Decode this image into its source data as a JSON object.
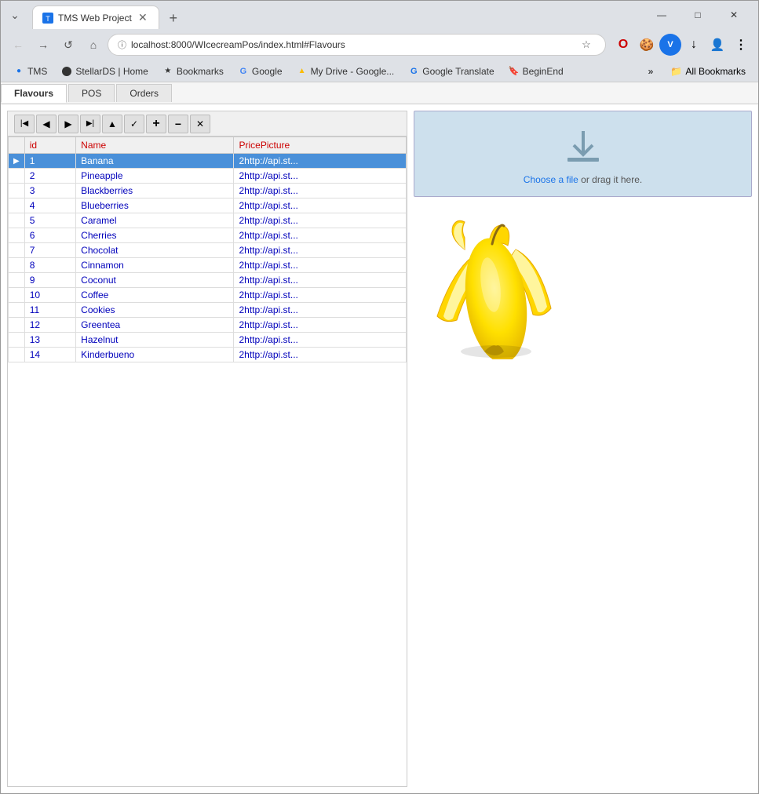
{
  "browser": {
    "tab_title": "TMS Web Project",
    "tab_favicon": "T",
    "address": "localhost:8000/WIcecreamPos/index.html#Flavours",
    "new_tab_label": "+",
    "window_controls": {
      "minimize": "—",
      "maximize": "□",
      "close": "✕"
    }
  },
  "nav_buttons": {
    "back": "←",
    "forward": "→",
    "refresh": "↺",
    "home": "⌂"
  },
  "address_icons": {
    "lock": "ⓘ",
    "star": "☆",
    "extensions": "🧩",
    "more": "⋮"
  },
  "browser_toolbar_icons": {
    "opera": "O",
    "cookie": "🍪",
    "vpn": "V",
    "download_ext": "↓",
    "profile": "👤",
    "more": "⋮"
  },
  "bookmarks": {
    "items": [
      {
        "label": "TMS",
        "icon": "●"
      },
      {
        "label": "StellarDS | Home",
        "icon": "●"
      },
      {
        "label": "Bookmarks",
        "icon": "★"
      },
      {
        "label": "Google",
        "icon": "G"
      },
      {
        "label": "My Drive - Google...",
        "icon": "▲"
      },
      {
        "label": "Google Translate",
        "icon": "G"
      },
      {
        "label": "BeginEnd",
        "icon": "🔖"
      }
    ],
    "more": "»",
    "all_bookmarks_icon": "📁",
    "all_bookmarks_label": "All Bookmarks"
  },
  "page_tabs": [
    {
      "label": "Flavours",
      "active": true
    },
    {
      "label": "POS",
      "active": false
    },
    {
      "label": "Orders",
      "active": false
    }
  ],
  "toolbar_buttons": [
    {
      "name": "first",
      "icon": "|◀"
    },
    {
      "name": "prev",
      "icon": "◀"
    },
    {
      "name": "next",
      "icon": "▶"
    },
    {
      "name": "last",
      "icon": "▶|"
    },
    {
      "name": "up",
      "icon": "▲"
    },
    {
      "name": "check",
      "icon": "✓"
    },
    {
      "name": "add",
      "icon": "+"
    },
    {
      "name": "minus",
      "icon": "−"
    },
    {
      "name": "close",
      "icon": "✕"
    }
  ],
  "table": {
    "columns": [
      "id",
      "Name",
      "PricePicture"
    ],
    "rows": [
      {
        "id": "1",
        "name": "Banana",
        "price": "2http://api.st...",
        "selected": true
      },
      {
        "id": "2",
        "name": "Pineapple",
        "price": "2http://api.st..."
      },
      {
        "id": "3",
        "name": "Blackberries",
        "price": "2http://api.st..."
      },
      {
        "id": "4",
        "name": "Blueberries",
        "price": "2http://api.st..."
      },
      {
        "id": "5",
        "name": "Caramel",
        "price": "2http://api.st..."
      },
      {
        "id": "6",
        "name": "Cherries",
        "price": "2http://api.st..."
      },
      {
        "id": "7",
        "name": "Chocolat",
        "price": "2http://api.st..."
      },
      {
        "id": "8",
        "name": "Cinnamon",
        "price": "2http://api.st..."
      },
      {
        "id": "9",
        "name": "Coconut",
        "price": "2http://api.st..."
      },
      {
        "id": "10",
        "name": "Coffee",
        "price": "2http://api.st..."
      },
      {
        "id": "11",
        "name": "Cookies",
        "price": "2http://api.st..."
      },
      {
        "id": "12",
        "name": "Greentea",
        "price": "2http://api.st..."
      },
      {
        "id": "13",
        "name": "Hazelnut",
        "price": "2http://api.st..."
      },
      {
        "id": "14",
        "name": "Kinderbueno",
        "price": "2http://api.st..."
      }
    ]
  },
  "upload": {
    "text_before": "Choose a file",
    "text_connector": " or ",
    "text_after": "drag it here."
  }
}
